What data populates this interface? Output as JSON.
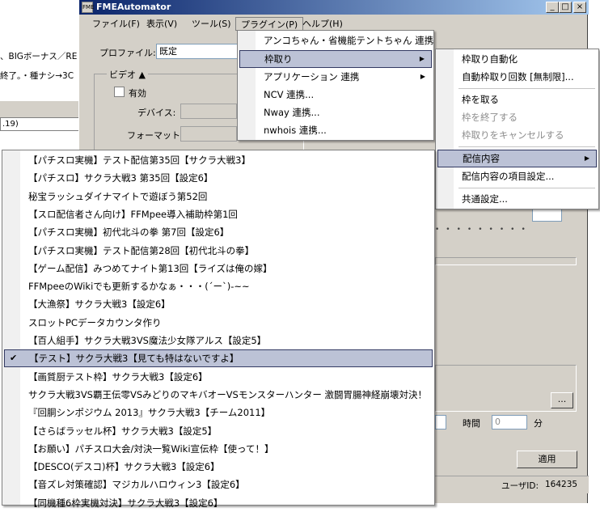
{
  "background_window": {
    "line1": "、BIGボーナス／RE",
    "line2": "終了。・種ナシ→3C",
    "field_text": ".19)"
  },
  "app": {
    "title": "FMEAutomator",
    "icon_text": "FME",
    "caption_minimize": "_",
    "caption_maximize": "□",
    "caption_close": "×",
    "menubar": [
      "ファイル(F)",
      "表示(V)",
      "ツール(S)",
      "プラグイン(P)",
      "ヘルプ(H)"
    ],
    "profile_label": "プロファイル:",
    "profile_value": "既定",
    "video_group_label": "ビデオ",
    "video_enable_label": "有効",
    "device_label": "デバイス:",
    "format_label": "フォーマット:",
    "browse_button": "...",
    "time_label": "時間",
    "minute_label": "分",
    "minute_value": "0",
    "apply_button": "適用",
    "user_id_label": "ユーザID:",
    "user_id": "164235"
  },
  "plugin_menu": {
    "items": [
      {
        "label": "アンコちゃん・省機能テントちゃん 連携",
        "submenu": false
      },
      {
        "label": "枠取り",
        "submenu": true
      },
      {
        "label": "アプリケーション 連携",
        "submenu": true
      },
      {
        "label": "NCV 連携...",
        "submenu": false
      },
      {
        "label": "Nway 連携...",
        "submenu": false
      },
      {
        "label": "nwhois 連携...",
        "submenu": false
      }
    ],
    "arrow": "▶"
  },
  "waku_menu": {
    "items": [
      {
        "label": "枠取り自動化",
        "disabled": false
      },
      {
        "label": "自動枠取り回数 [無制限]...",
        "disabled": false
      },
      {
        "label": "枠を取る",
        "disabled": false
      },
      {
        "label": "枠を終了する",
        "disabled": true
      },
      {
        "label": "枠取りをキャンセルする",
        "disabled": true
      },
      {
        "label": "配信内容",
        "disabled": false
      },
      {
        "label": "配信内容の項目設定...",
        "disabled": false
      },
      {
        "label": "共通設定...",
        "disabled": false
      }
    ],
    "arrow": "▶"
  },
  "haishin_menu": {
    "check_glyph": "✔",
    "items": [
      {
        "label": "【パチスロ実機】テスト配信第35回【サクラ大戦3】",
        "checked": false
      },
      {
        "label": "【パチスロ】サクラ大戦3 第35回【設定6】",
        "checked": false
      },
      {
        "label": "秘宝ラッシュダイナマイトで遊ぼう第52回",
        "checked": false
      },
      {
        "label": "【スロ配信者さん向け】FFMpee導入補助枠第1回",
        "checked": false
      },
      {
        "label": "【パチスロ実機】初代北斗の拳 第7回【設定6】",
        "checked": false
      },
      {
        "label": "【パチスロ実機】テスト配信第28回【初代北斗の拳】",
        "checked": false
      },
      {
        "label": "【ゲーム配信】みつめてナイト第13回【ライズは俺の嫁】",
        "checked": false
      },
      {
        "label": "FFMpeeのWikiでも更新するかなぁ・・・(´ー`)-~~",
        "checked": false
      },
      {
        "label": "【大漁祭】サクラ大戦3【設定6】",
        "checked": false
      },
      {
        "label": "スロットPCデータカウンタ作り",
        "checked": false
      },
      {
        "label": "【百人組手】サクラ大戦3VS魔法少女隊アルス【設定5】",
        "checked": false
      },
      {
        "label": "【テスト】サクラ大戦3【見ても特はないですよ】",
        "checked": true
      },
      {
        "label": "【画質厨テスト枠】サクラ大戦3【設定6】",
        "checked": false
      },
      {
        "label": "サクラ大戦3VS覇王伝零VSみどりのマキバオーVSモンスターハンター 激闘胃腸神経崩壊対決！",
        "checked": false
      },
      {
        "label": "『回胴シンポジウム 2013』サクラ大戦3【チーム2011】",
        "checked": false
      },
      {
        "label": "【さらばラッセル杯】サクラ大戦3【設定5】",
        "checked": false
      },
      {
        "label": "【お願い】パチスロ大会/対決一覧Wiki宣伝枠【使って！】",
        "checked": false
      },
      {
        "label": "【DESCO(デスコ)杯】サクラ大戦3【設定6】",
        "checked": false
      },
      {
        "label": "【音ズレ対策確認】マジカルハロウィン3【設定6】",
        "checked": false
      },
      {
        "label": "【同機種6枠実機対決】サクラ大戦3【設定6】",
        "checked": false
      }
    ]
  }
}
